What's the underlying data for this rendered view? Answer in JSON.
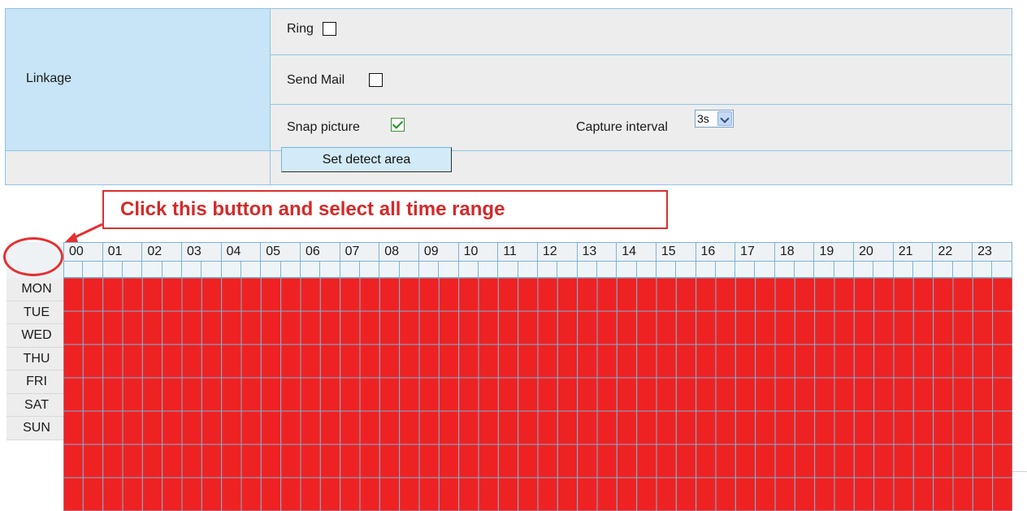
{
  "linkage": {
    "label": "Linkage",
    "ring_label": "Ring",
    "ring_checked": false,
    "mail_label": "Send Mail",
    "mail_checked": false,
    "snap_label": "Snap picture",
    "snap_checked": true,
    "interval_label": "Capture interval",
    "interval_value": "3s"
  },
  "detect_button_label": "Set detect area",
  "annotation": {
    "text": "Click this button and select all time range",
    "color": "#d42a2a"
  },
  "schedule": {
    "hours": [
      "00",
      "01",
      "02",
      "03",
      "04",
      "05",
      "06",
      "07",
      "08",
      "09",
      "10",
      "11",
      "12",
      "13",
      "14",
      "15",
      "16",
      "17",
      "18",
      "19",
      "20",
      "21",
      "22",
      "23"
    ],
    "days": [
      "MON",
      "TUE",
      "WED",
      "THU",
      "FRI",
      "SAT",
      "SUN"
    ],
    "fill_color": "#ee2222",
    "grid_color": "#7ab4d8",
    "all_selected": true
  }
}
